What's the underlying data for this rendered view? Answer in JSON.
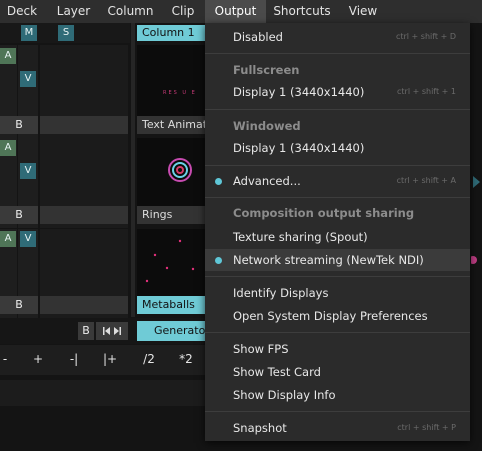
{
  "menubar": {
    "items": [
      {
        "label": "Deck"
      },
      {
        "label": "Layer"
      },
      {
        "label": "Column"
      },
      {
        "label": "Clip"
      },
      {
        "label": "Output"
      },
      {
        "label": "Shortcuts"
      },
      {
        "label": "View"
      }
    ],
    "active": "Output"
  },
  "layers": {
    "m_label": "M",
    "s_label": "S",
    "a_label": "A",
    "v_label": "V",
    "b_label": "B"
  },
  "column": {
    "label": "Column 1"
  },
  "clips": [
    {
      "label": "Text Animat",
      "preview_text": "RES U E"
    },
    {
      "label": "Rings"
    },
    {
      "label": "Metaballs"
    }
  ],
  "deck_bar": {
    "b_label": "B",
    "transport_icon": "skip-transport-icon",
    "generator_label": "Generato"
  },
  "toolbar": {
    "buttons": [
      "-",
      "+",
      "-|",
      "|+",
      "/2",
      "*2"
    ]
  },
  "colors": {
    "accent": "#5fc7d7",
    "menu_bg": "#2b2b2b",
    "hover_bg": "#3b3b3b"
  },
  "output_menu": {
    "disabled": {
      "label": "Disabled",
      "shortcut": "ctrl + shift + D"
    },
    "fullscreen_header": "Fullscreen",
    "fullscreen_display": {
      "label": "Display 1 (3440x1440)",
      "shortcut": "ctrl + shift + 1"
    },
    "windowed_header": "Windowed",
    "windowed_display": {
      "label": "Display 1 (3440x1440)"
    },
    "advanced": {
      "label": "Advanced...",
      "shortcut": "ctrl + shift + A"
    },
    "sharing_header": "Composition output sharing",
    "texture_sharing": {
      "label": "Texture sharing (Spout)"
    },
    "network_streaming": {
      "label": "Network streaming (NewTek NDI)"
    },
    "identify_displays": {
      "label": "Identify Displays"
    },
    "open_prefs": {
      "label": "Open System Display Preferences"
    },
    "show_fps": {
      "label": "Show FPS"
    },
    "show_test_card": {
      "label": "Show Test Card"
    },
    "show_display_info": {
      "label": "Show Display Info"
    },
    "snapshot": {
      "label": "Snapshot",
      "shortcut": "ctrl + shift + P"
    }
  }
}
